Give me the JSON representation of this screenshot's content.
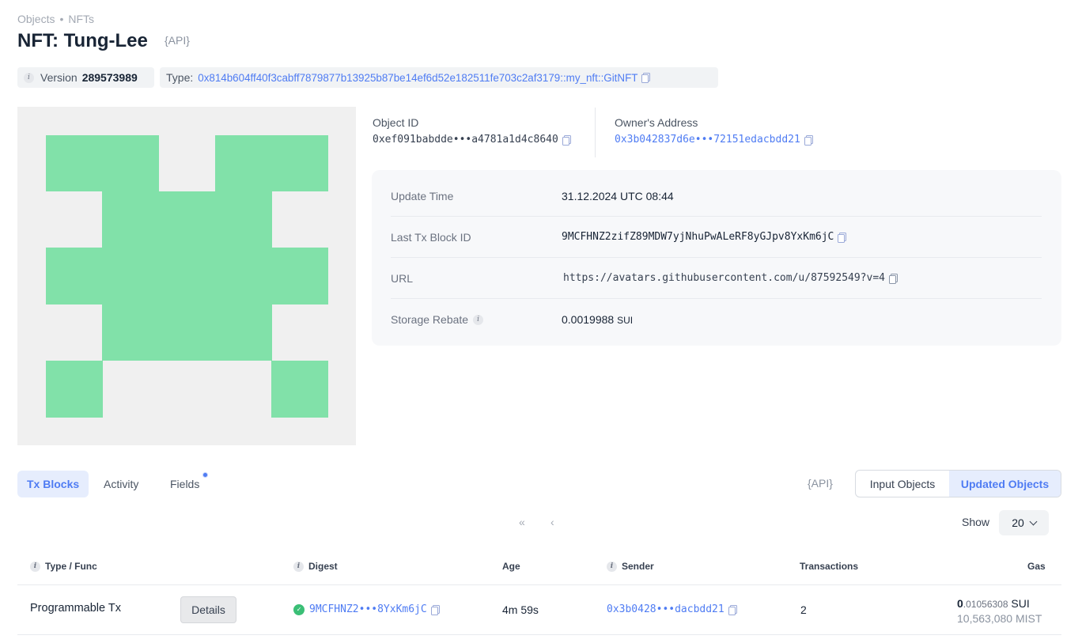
{
  "breadcrumb": {
    "item1": "Objects",
    "separator": "•",
    "item2": "NFTs"
  },
  "header": {
    "title": "NFT: Tung-Lee",
    "api_label": "{API}"
  },
  "meta": {
    "version_label": "Version",
    "version_value": "289573989",
    "type_label": "Type:",
    "type_value": "0x814b604ff40f3cabff7879877b13925b87be14ef6d52e182511fe703c2af3179::my_nft::GitNFT"
  },
  "nft_image": {
    "background": "#f0f0f0",
    "color": "#81e1a9"
  },
  "object": {
    "id_label": "Object ID",
    "id_value": "0xef091babdde•••a4781a1d4c8640",
    "owner_label": "Owner's Address",
    "owner_value": "0x3b042837d6e•••72151edacbdd21"
  },
  "details": [
    {
      "label": "Update Time",
      "value": "31.12.2024 UTC 08:44"
    },
    {
      "label": "Last Tx Block ID",
      "value": "9MCFHNZ2zifZ89MDW7yjNhuPwALeRF8yGJpv8YxKm6jC"
    },
    {
      "label": "URL",
      "value": "https://avatars.githubusercontent.com/u/87592549?v=4"
    },
    {
      "label": "Storage Rebate",
      "value": "0.0019988",
      "unit": "SUI"
    }
  ],
  "tabs": [
    "Tx Blocks",
    "Activity",
    "Fields"
  ],
  "segmented": {
    "api_label": "{API}",
    "option1": "Input Objects",
    "option2": "Updated Objects"
  },
  "pagination": {
    "first": "«",
    "prev": "‹",
    "show_label": "Show",
    "page_size": "20"
  },
  "table": {
    "headers": [
      "Type / Func",
      "Digest",
      "Age",
      "Sender",
      "Transactions",
      "Gas"
    ],
    "rows": [
      {
        "type": "Programmable Tx",
        "action": "Details",
        "digest": "9MCFHNZ2•••8YxKm6jC",
        "age": "4m 59s",
        "sender": "0x3b0428•••dacbdd21",
        "transactions": "2",
        "gas_int": "0",
        "gas_frac": ".01056308",
        "gas_unit": "SUI",
        "gas_mist": "10,563,080 MIST"
      }
    ]
  },
  "colors": {
    "accent": "#4f7cf3",
    "success": "#3bbf76",
    "nft_green": "#81e1a9"
  }
}
